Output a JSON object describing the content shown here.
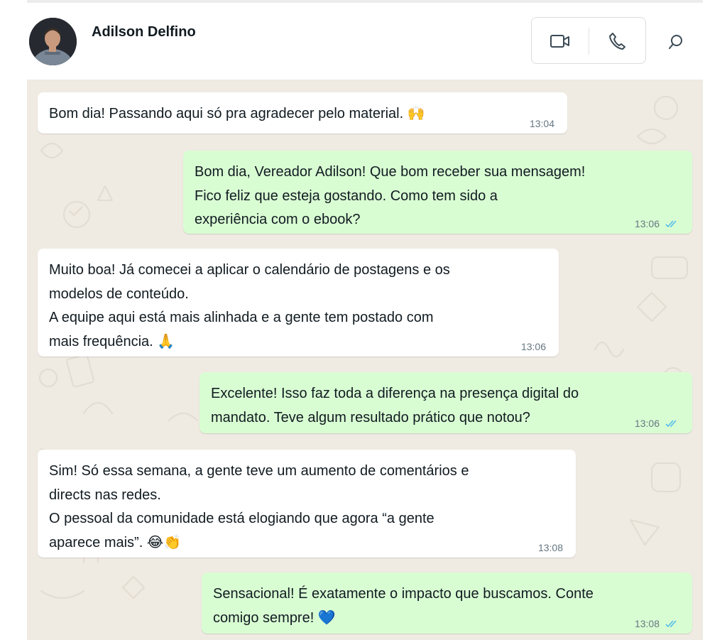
{
  "contact": {
    "name": "Adilson Delfino"
  },
  "header": {
    "icons": [
      "video-call-icon",
      "voice-call-icon",
      "search-icon"
    ]
  },
  "colors": {
    "incoming_bubble": "#ffffff",
    "outgoing_bubble": "#d9fdd3",
    "chat_background": "#efeae2",
    "read_ticks": "#53bdeb",
    "timestamp": "#667781"
  },
  "messages": [
    {
      "direction": "in",
      "text": "Bom dia! Passando aqui só pra agradecer pelo material. 🙌",
      "time": "13:04"
    },
    {
      "direction": "out",
      "text": "Bom dia, Vereador Adilson! Que bom receber sua mensagem!\nFico feliz que esteja gostando. Como tem sido a\nexperiência com o ebook?",
      "time": "13:06",
      "status": "read"
    },
    {
      "direction": "in",
      "text": "Muito boa! Já comecei a aplicar o calendário de postagens e os\nmodelos de conteúdo.\nA equipe aqui está mais alinhada e a gente tem postado com\nmais frequência. 🙏",
      "time": "13:06"
    },
    {
      "direction": "out",
      "text": "Excelente! Isso faz toda a diferença na presença digital do\nmandato. Teve algum resultado prático que notou?",
      "time": "13:06",
      "status": "read"
    },
    {
      "direction": "in",
      "text": "Sim! Só essa semana, a gente teve um aumento de comentários e\ndirects nas redes.\nO pessoal da comunidade está elogiando que agora “a gente\naparece mais”. 😂👏",
      "time": "13:08"
    },
    {
      "direction": "out",
      "text": "Sensacional! É exatamente o impacto que buscamos. Conte\ncomigo sempre! 💙",
      "time": "13:08",
      "status": "read"
    }
  ]
}
